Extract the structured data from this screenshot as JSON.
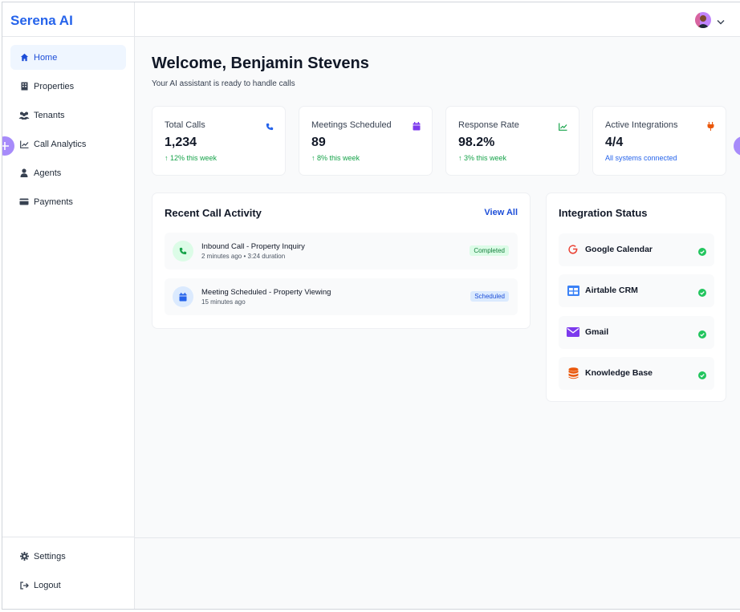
{
  "app": {
    "brand": "Serena AI"
  },
  "sidebar": {
    "items": [
      {
        "label": "Home",
        "icon": "home-icon",
        "active": true
      },
      {
        "label": "Properties",
        "icon": "building-icon"
      },
      {
        "label": "Tenants",
        "icon": "users-icon"
      },
      {
        "label": "Call Analytics",
        "icon": "chart-line-icon"
      },
      {
        "label": "Agents",
        "icon": "user-tie-icon"
      },
      {
        "label": "Payments",
        "icon": "credit-card-icon"
      }
    ],
    "bottom": [
      {
        "label": "Settings",
        "icon": "gear-icon"
      },
      {
        "label": "Logout",
        "icon": "logout-icon"
      }
    ]
  },
  "header": {
    "avatar": "user-avatar",
    "menu_icon": "chevron-down-icon"
  },
  "main": {
    "welcome": "Welcome, Benjamin Stevens",
    "subtitle": "Your AI assistant is ready to handle calls",
    "stats": [
      {
        "label": "Total Calls",
        "value": "1,234",
        "delta": "12% this week",
        "icon": "phone-icon",
        "color": "#2563eb"
      },
      {
        "label": "Meetings Scheduled",
        "value": "89",
        "delta": "8% this week",
        "icon": "calendar-icon",
        "color": "#7c3aed"
      },
      {
        "label": "Response Rate",
        "value": "98.2%",
        "delta": "3% this week",
        "icon": "chart-line-icon",
        "color": "#16a34a"
      },
      {
        "label": "Active Integrations",
        "value": "4/4",
        "delta": "All systems connected",
        "icon": "plug-icon",
        "color": "#ea580c"
      }
    ],
    "recent": {
      "title": "Recent Call Activity",
      "view_all": "View All",
      "items": [
        {
          "title": "Inbound Call - Property Inquiry",
          "sub": "2 minutes ago • 3:24 duration",
          "status": "Completed",
          "icon": "phone-icon"
        },
        {
          "title": "Meeting Scheduled - Property Viewing",
          "sub": "15 minutes ago",
          "status": "Scheduled",
          "icon": "calendar-icon"
        }
      ]
    },
    "integrations": {
      "title": "Integration Status",
      "items": [
        {
          "name": "Google Calendar",
          "icon": "google-icon",
          "color": "#ea4335"
        },
        {
          "name": "Airtable CRM",
          "icon": "table-icon",
          "color": "#3b82f6"
        },
        {
          "name": "Gmail",
          "icon": "envelope-icon",
          "color": "#7c3aed"
        },
        {
          "name": "Knowledge Base",
          "icon": "database-icon",
          "color": "#ea580c"
        }
      ]
    }
  }
}
